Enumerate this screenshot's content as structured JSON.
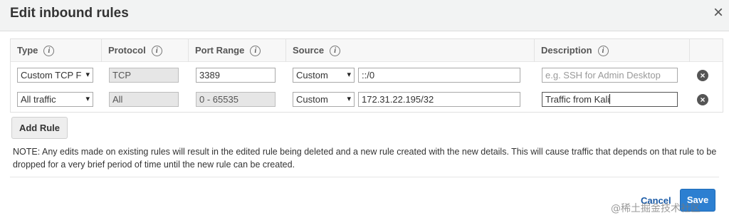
{
  "dialog": {
    "title": "Edit inbound rules",
    "close_icon": "×"
  },
  "table": {
    "headers": {
      "type": "Type",
      "protocol": "Protocol",
      "port_range": "Port Range",
      "source": "Source",
      "description": "Description"
    },
    "info_icon": "i",
    "rows": [
      {
        "type": "Custom TCP F",
        "protocol": "TCP",
        "port_range": "3389",
        "source_type": "Custom",
        "source_value": "::/0",
        "description_placeholder": "e.g. SSH for Admin Desktop",
        "description": ""
      },
      {
        "type": "All traffic",
        "protocol": "All",
        "port_range": "0 - 65535",
        "source_type": "Custom",
        "source_value": "172.31.22.195/32",
        "description_placeholder": "",
        "description": "Traffic from Kali"
      }
    ],
    "remove_icon": "×"
  },
  "add_rule_label": "Add Rule",
  "note": "NOTE: Any edits made on existing rules will result in the edited rule being deleted and a new rule created with the new details. This will cause traffic that depends on that rule to be dropped for a very brief period of time until the new rule can be created.",
  "footer": {
    "cancel_label": "Cancel",
    "save_label": "Save"
  },
  "watermark": "@稀土掘金技术社区"
}
